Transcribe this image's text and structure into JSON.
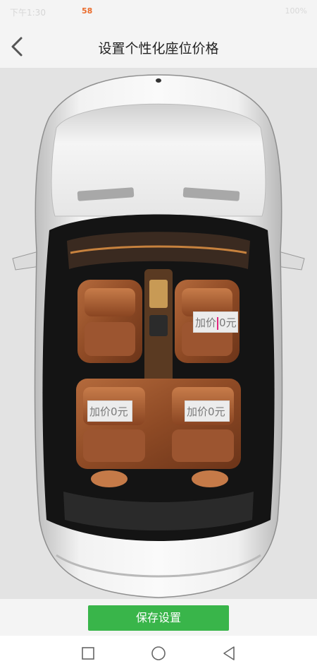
{
  "status_bar": {
    "time": "下午1:30",
    "app_icon": "58",
    "right": "100%"
  },
  "header": {
    "back_icon": "chevron-left-icon",
    "title": "设置个性化座位价格"
  },
  "seats": {
    "front_right": {
      "prefix": "加价",
      "value": "0",
      "unit": "元"
    },
    "rear_left": {
      "prefix": "加价",
      "value": "0",
      "unit": "元"
    },
    "rear_right": {
      "prefix": "加价",
      "value": "0",
      "unit": "元"
    }
  },
  "save_label": "保存设置",
  "nav_bar": {
    "recent_icon": "square-icon",
    "home_icon": "circle-icon",
    "back_icon": "triangle-back-icon"
  },
  "colors": {
    "accent_green": "#39b54a",
    "caret_pink": "#e0257d",
    "seat_leather": "#8e4a25"
  }
}
